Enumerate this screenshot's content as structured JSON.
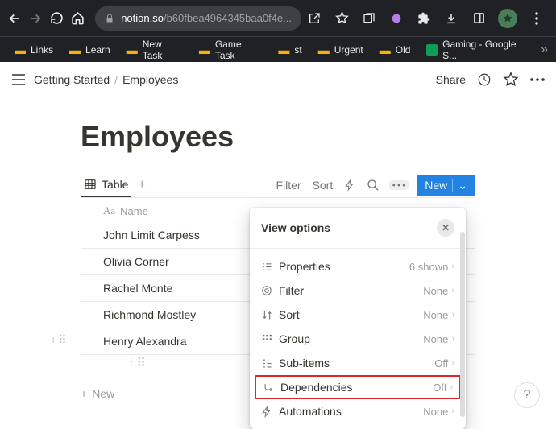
{
  "browser": {
    "url_host": "notion.so",
    "url_path": "/b60fbea4964345baa0f4e...",
    "bookmarks": [
      "Links",
      "Learn",
      "New Task",
      "Game Task",
      "st",
      "Urgent",
      "Old",
      "Gaming - Google S..."
    ]
  },
  "header": {
    "breadcrumb_root": "Getting Started",
    "breadcrumb_current": "Employees",
    "share": "Share"
  },
  "page": {
    "title": "Employees"
  },
  "tabs": {
    "table_label": "Table",
    "filter": "Filter",
    "sort": "Sort",
    "new": "New"
  },
  "table": {
    "col_name": "Name",
    "rows": [
      "John Limit Carpess",
      "Olivia Corner",
      "Rachel Monte",
      "Richmond Mostley",
      "Henry Alexandra"
    ],
    "new_row": "New"
  },
  "popover": {
    "title": "View options",
    "items": [
      {
        "label": "Properties",
        "value": "6 shown"
      },
      {
        "label": "Filter",
        "value": "None"
      },
      {
        "label": "Sort",
        "value": "None"
      },
      {
        "label": "Group",
        "value": "None"
      },
      {
        "label": "Sub-items",
        "value": "Off"
      },
      {
        "label": "Dependencies",
        "value": "Off"
      },
      {
        "label": "Automations",
        "value": "None"
      }
    ]
  },
  "help": "?"
}
